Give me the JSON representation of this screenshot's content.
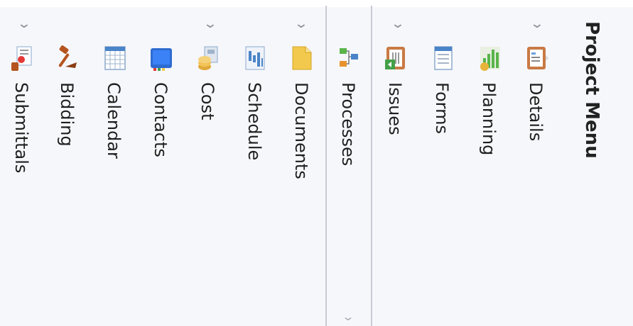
{
  "menu": {
    "title": "Project Menu",
    "group_a": {
      "items": [
        {
          "label": "Details",
          "icon": "details-icon"
        },
        {
          "label": "Planning",
          "icon": "planning-icon"
        },
        {
          "label": "Forms",
          "icon": "forms-icon"
        },
        {
          "label": "Issues",
          "icon": "issues-icon"
        }
      ]
    },
    "processes": {
      "label": "Processes",
      "icon": "processes-icon"
    },
    "group_b": {
      "items": [
        {
          "label": "Documents",
          "icon": "documents-icon"
        },
        {
          "label": "Schedule",
          "icon": "schedule-icon"
        },
        {
          "label": "Cost",
          "icon": "cost-icon"
        },
        {
          "label": "Contacts",
          "icon": "contacts-icon"
        },
        {
          "label": "Calendar",
          "icon": "calendar-icon"
        },
        {
          "label": "Bidding",
          "icon": "bidding-icon"
        },
        {
          "label": "Submittals",
          "icon": "submittals-icon"
        }
      ]
    }
  },
  "colors": {
    "background": "#f6f7fb",
    "divider": "#c9ccd4",
    "text": "#1f1f1f",
    "chevron": "#8a8d95"
  }
}
